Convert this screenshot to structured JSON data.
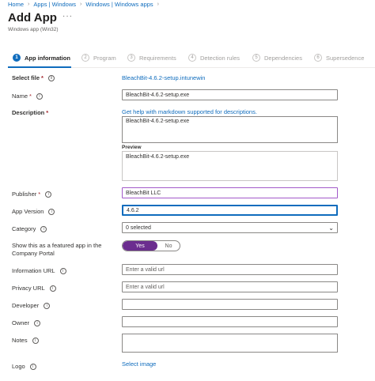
{
  "breadcrumb": [
    "Home",
    "Apps | Windows",
    "Windows | Windows apps"
  ],
  "header": {
    "title": "Add App",
    "more": "···",
    "subtitle": "Windows app (Win32)"
  },
  "steps": [
    {
      "num": "1",
      "label": "App information"
    },
    {
      "num": "2",
      "label": "Program"
    },
    {
      "num": "3",
      "label": "Requirements"
    },
    {
      "num": "4",
      "label": "Detection rules"
    },
    {
      "num": "5",
      "label": "Dependencies"
    },
    {
      "num": "6",
      "label": "Supersedence"
    }
  ],
  "form": {
    "select_file": {
      "label": "Select file",
      "req": "*",
      "value": "BleachBit-4.6.2-setup.intunewin"
    },
    "name": {
      "label": "Name",
      "req": "*",
      "value": "BleachBit-4.6.2-setup.exe"
    },
    "description": {
      "label": "Description",
      "req": "*",
      "help_link": "Get help with markdown supported for descriptions.",
      "value": "BleachBit-4.6.2-setup.exe",
      "preview_label": "Preview",
      "preview_value": "BleachBit-4.6.2-setup.exe"
    },
    "publisher": {
      "label": "Publisher",
      "req": "*",
      "value": "BleachBit LLC"
    },
    "app_version": {
      "label": "App Version",
      "value": "4.6.2"
    },
    "category": {
      "label": "Category",
      "value": "0 selected"
    },
    "featured": {
      "label_line1": "Show this as a featured app in the",
      "label_line2": "Company Portal",
      "yes": "Yes",
      "no": "No",
      "selected": "Yes"
    },
    "information_url": {
      "label": "Information URL",
      "placeholder": "Enter a valid url"
    },
    "privacy_url": {
      "label": "Privacy URL",
      "placeholder": "Enter a valid url"
    },
    "developer": {
      "label": "Developer",
      "value": ""
    },
    "owner": {
      "label": "Owner",
      "value": ""
    },
    "notes": {
      "label": "Notes",
      "value": ""
    },
    "logo": {
      "label": "Logo",
      "link": "Select image"
    }
  },
  "colors": {
    "accent": "#0f6cbd",
    "toggle_on": "#6b2d8f",
    "required": "#a4262c"
  },
  "icons": {
    "info": "info-icon",
    "chevron": "chevron-down-icon",
    "breadcrumb_sep": "chevron-right-icon"
  }
}
